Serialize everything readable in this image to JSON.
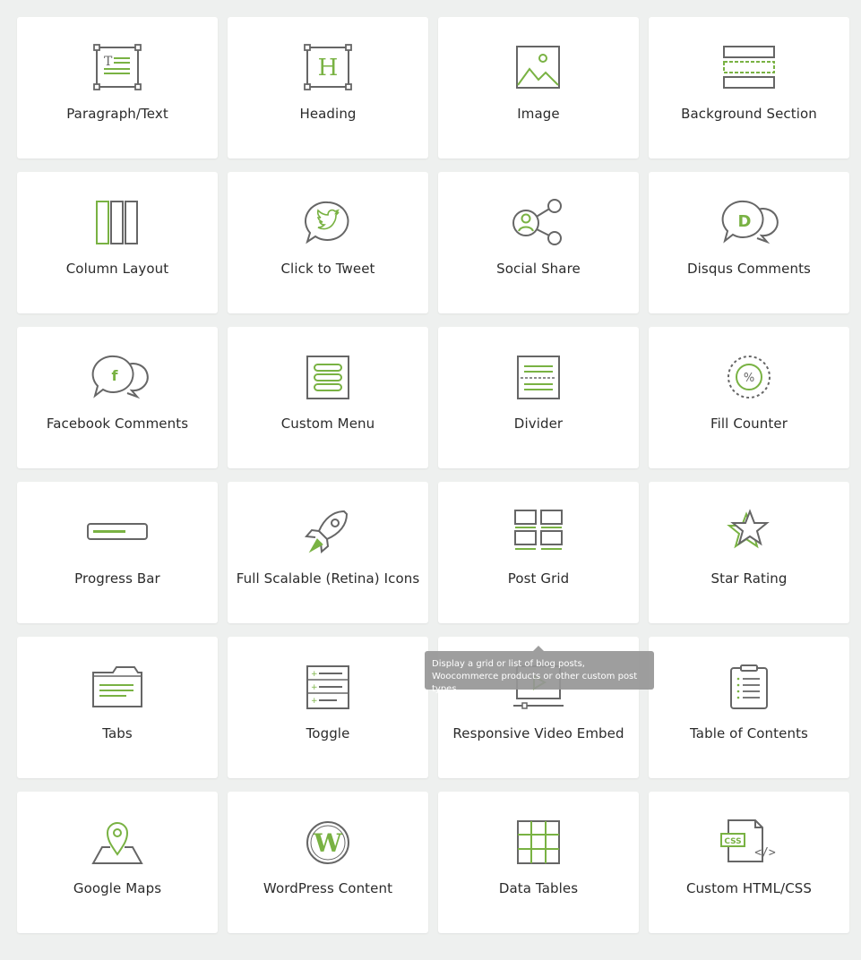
{
  "colors": {
    "accent": "#79b243",
    "stroke": "#666666",
    "card_bg": "#ffffff",
    "page_bg": "#eef0ef",
    "text": "#2b2b2b"
  },
  "modules": [
    {
      "label": "Paragraph/Text",
      "icon": "paragraph-text-icon"
    },
    {
      "label": "Heading",
      "icon": "heading-icon"
    },
    {
      "label": "Image",
      "icon": "image-icon"
    },
    {
      "label": "Background Section",
      "icon": "background-section-icon"
    },
    {
      "label": "Column Layout",
      "icon": "column-layout-icon"
    },
    {
      "label": "Click to Tweet",
      "icon": "click-to-tweet-icon"
    },
    {
      "label": "Social Share",
      "icon": "social-share-icon"
    },
    {
      "label": "Disqus Comments",
      "icon": "disqus-comments-icon"
    },
    {
      "label": "Facebook Comments",
      "icon": "facebook-comments-icon"
    },
    {
      "label": "Custom Menu",
      "icon": "custom-menu-icon"
    },
    {
      "label": "Divider",
      "icon": "divider-icon"
    },
    {
      "label": "Fill Counter",
      "icon": "fill-counter-icon"
    },
    {
      "label": "Progress Bar",
      "icon": "progress-bar-icon"
    },
    {
      "label": "Full Scalable (Retina) Icons",
      "icon": "rocket-icon"
    },
    {
      "label": "Post Grid",
      "icon": "post-grid-icon"
    },
    {
      "label": "Star Rating",
      "icon": "star-rating-icon"
    },
    {
      "label": "Tabs",
      "icon": "tabs-icon"
    },
    {
      "label": "Toggle",
      "icon": "toggle-icon"
    },
    {
      "label": "Responsive Video Embed",
      "icon": "video-embed-icon"
    },
    {
      "label": "Table of Contents",
      "icon": "table-of-contents-icon"
    },
    {
      "label": "Google Maps",
      "icon": "google-maps-icon"
    },
    {
      "label": "WordPress Content",
      "icon": "wordpress-icon"
    },
    {
      "label": "Data Tables",
      "icon": "data-tables-icon"
    },
    {
      "label": "Custom HTML/CSS",
      "icon": "custom-html-css-icon"
    }
  ],
  "icon_text": {
    "paragraph_glyph": "T",
    "heading_glyph": "H",
    "disqus_glyph": "D",
    "facebook_glyph": "f",
    "percent_glyph": "%",
    "css_glyph": "CSS",
    "code_glyph": "</>",
    "wordpress_glyph": "W"
  },
  "tooltip": {
    "text": "Display a grid or list of blog posts, Woocommerce products or other custom post types."
  }
}
